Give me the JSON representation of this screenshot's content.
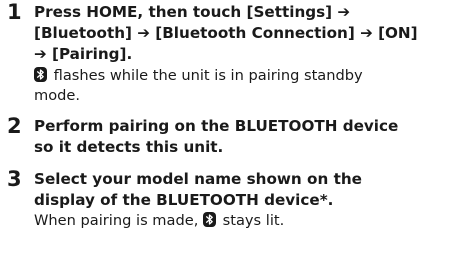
{
  "steps": [
    {
      "number": "1",
      "lines": [
        {
          "t1": "Press HOME, then touch [Settings] ",
          "arrow": "➔"
        },
        {
          "t1": "[Bluetooth] ",
          "a1": "➔",
          "t2": " [Bluetooth Connection] ",
          "a2": "➔",
          "t3": " [ON]"
        },
        {
          "a1": "➔",
          "t1": " [Pairing]."
        }
      ],
      "note": {
        "line1": " flashes while the unit is in pairing standby",
        "line2": "mode."
      }
    },
    {
      "number": "2",
      "lines": [
        {
          "t1": "Perform pairing on the BLUETOOTH device"
        },
        {
          "t1": "so it detects this unit."
        }
      ]
    },
    {
      "number": "3",
      "lines": [
        {
          "t1": "Select your model name shown on the"
        },
        {
          "t1": "display of the BLUETOOTH device*."
        }
      ],
      "note": {
        "before": "When pairing is made, ",
        "after": " stays lit."
      }
    }
  ],
  "icons": {
    "bluetooth": "bluetooth-icon"
  },
  "colors": {
    "text": "#1a1a1a",
    "background": "#ffffff"
  }
}
